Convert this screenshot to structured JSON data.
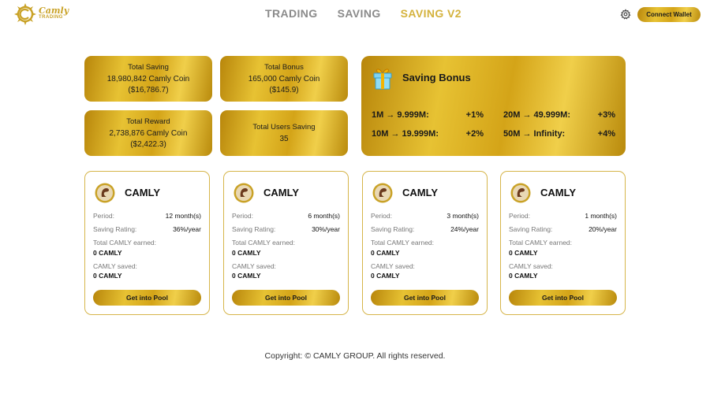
{
  "logo": {
    "line1": "Camly",
    "line2": "TRADING"
  },
  "nav": [
    {
      "label": "TRADING",
      "active": false
    },
    {
      "label": "SAVING",
      "active": false
    },
    {
      "label": "SAVING V2",
      "active": true
    }
  ],
  "header": {
    "connect_label": "Connect Wallet",
    "settings_icon": "gear-icon"
  },
  "stats": {
    "total_saving": {
      "title": "Total Saving",
      "line1": "18,980,842 Camly Coin",
      "line2": "($16,786.7)"
    },
    "total_bonus": {
      "title": "Total Bonus",
      "line1": "165,000 Camly Coin",
      "line2": "($145.9)"
    },
    "total_reward": {
      "title": "Total Reward",
      "line1": "2,738,876 Camly Coin",
      "line2": "($2,422.3)"
    },
    "total_users": {
      "title": "Total Users Saving",
      "line1": "35"
    }
  },
  "bonus": {
    "title": "Saving Bonus",
    "icon": "gift-icon",
    "tiers": [
      {
        "range": "1M → 9.999M:",
        "rate": "+1%"
      },
      {
        "range": "20M → 49.999M:",
        "rate": "+3%"
      },
      {
        "range": "10M → 19.999M:",
        "rate": "+2%"
      },
      {
        "range": "50M → Infinity:",
        "rate": "+4%"
      }
    ]
  },
  "pool_labels": {
    "period": "Period:",
    "rating": "Saving Rating:",
    "earned": "Total CAMLY earned:",
    "saved": "CAMLY saved:",
    "button": "Get into Pool"
  },
  "pools": [
    {
      "name": "CAMLY",
      "period": "12 month(s)",
      "rating": "36%/year",
      "earned": "0 CAMLY",
      "saved": "0 CAMLY"
    },
    {
      "name": "CAMLY",
      "period": "6 month(s)",
      "rating": "30%/year",
      "earned": "0 CAMLY",
      "saved": "0 CAMLY"
    },
    {
      "name": "CAMLY",
      "period": "3 month(s)",
      "rating": "24%/year",
      "earned": "0 CAMLY",
      "saved": "0 CAMLY"
    },
    {
      "name": "CAMLY",
      "period": "1 month(s)",
      "rating": "20%/year",
      "earned": "0 CAMLY",
      "saved": "0 CAMLY"
    }
  ],
  "footer": {
    "copyright": "Copyright: © CAMLY GROUP. All rights reserved."
  },
  "colors": {
    "gold": "#d4a418",
    "gold_light": "#f0cf4a",
    "nav_active": "#d4b23c",
    "nav_inactive": "#8a8a8a"
  }
}
